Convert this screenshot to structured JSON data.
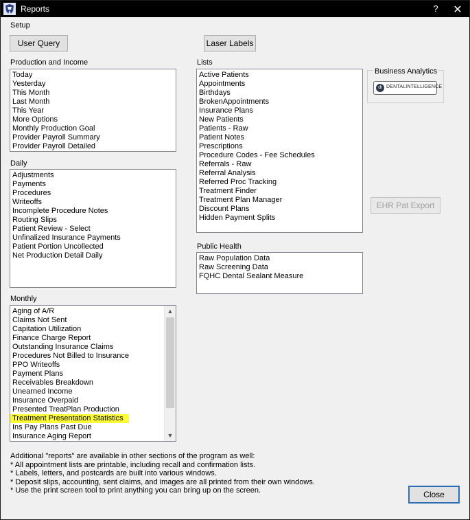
{
  "window": {
    "title": "Reports",
    "help_label": "?",
    "close_glyph": "✕"
  },
  "menu": {
    "setup": "Setup"
  },
  "buttons": {
    "user_query": "User Query",
    "laser_labels": "Laser Labels",
    "ehr_pat_export": "EHR Pat Export",
    "close": "Close"
  },
  "production": {
    "label": "Production and Income",
    "items": [
      "Today",
      "Yesterday",
      "This Month",
      "Last Month",
      "This Year",
      "More Options",
      "Monthly Production Goal",
      "Provider Payroll Summary",
      "Provider Payroll Detailed"
    ]
  },
  "daily": {
    "label": "Daily",
    "items": [
      "Adjustments",
      "Payments",
      "Procedures",
      "Writeoffs",
      "Incomplete Procedure Notes",
      "Routing Slips",
      "Patient Review - Select",
      "Unfinalized Insurance Payments",
      "Patient Portion Uncollected",
      "Net Production Detail Daily"
    ]
  },
  "monthly": {
    "label": "Monthly",
    "items": [
      "Aging of A/R",
      "Claims Not Sent",
      "Capitation Utilization",
      "Finance Charge Report",
      "Outstanding Insurance Claims",
      "Procedures Not Billed to Insurance",
      "PPO Writeoffs",
      "Payment Plans",
      "Receivables Breakdown",
      "Unearned Income",
      "Insurance Overpaid",
      "Presented TreatPlan Production",
      "Treatment Presentation Statistics",
      "Ins Pay Plans Past Due",
      "Insurance Aging Report"
    ],
    "highlighted_index": 12,
    "highlight_color": "#ffff33"
  },
  "lists": {
    "label": "Lists",
    "items": [
      "Active Patients",
      "Appointments",
      "Birthdays",
      "BrokenAppointments",
      "Insurance Plans",
      "New Patients",
      "Patients - Raw",
      "Patient Notes",
      "Prescriptions",
      "Procedure Codes - Fee Schedules",
      "Referrals - Raw",
      "Referral Analysis",
      "Referred Proc Tracking",
      "Treatment Finder",
      "Treatment Plan Manager",
      "Discount Plans",
      "Hidden Payment Splits"
    ]
  },
  "public_health": {
    "label": "Public Health",
    "items": [
      "Raw Population Data",
      "Raw Screening Data",
      "FQHC Dental Sealant Measure"
    ]
  },
  "business_analytics": {
    "label": "Business Analytics",
    "logo_text": "DENTALINTELLIGENCE",
    "logo_mark": "di"
  },
  "notes": [
    "Additional \"reports\" are available in other sections of the program as well:",
    "* All appointment lists are printable, including recall and confirmation lists.",
    "* Labels, letters, and postcards are built into various windows.",
    "* Deposit slips, accounting, sent claims, and images are all printed from their own windows.",
    "* Use the print screen tool to print anything you can bring up on the screen."
  ]
}
